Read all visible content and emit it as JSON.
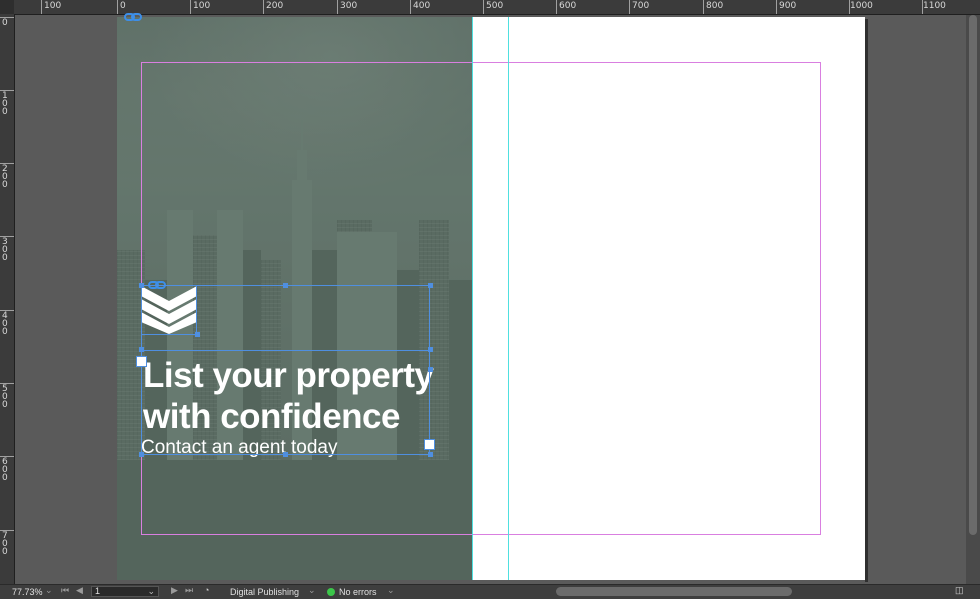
{
  "rulers": {
    "horizontal": [
      "100",
      "0",
      "100",
      "200",
      "300",
      "400",
      "500",
      "600",
      "700",
      "800",
      "900",
      "1000",
      "1100"
    ],
    "vertical": [
      "0",
      "100",
      "200",
      "300",
      "400",
      "500",
      "600",
      "700"
    ]
  },
  "document": {
    "headline_line1": "List your property",
    "headline_line2": "with confidence",
    "subline": "Contact an agent today"
  },
  "statusbar": {
    "zoom": "77.73%",
    "page": "1",
    "workspace": "Digital Publishing",
    "preflight": "No errors"
  },
  "colors": {
    "margin_guide": "#d97fe0",
    "column_guide": "#4fe0e0",
    "selection": "#4f8fe0",
    "overlay": "#5f7068"
  }
}
